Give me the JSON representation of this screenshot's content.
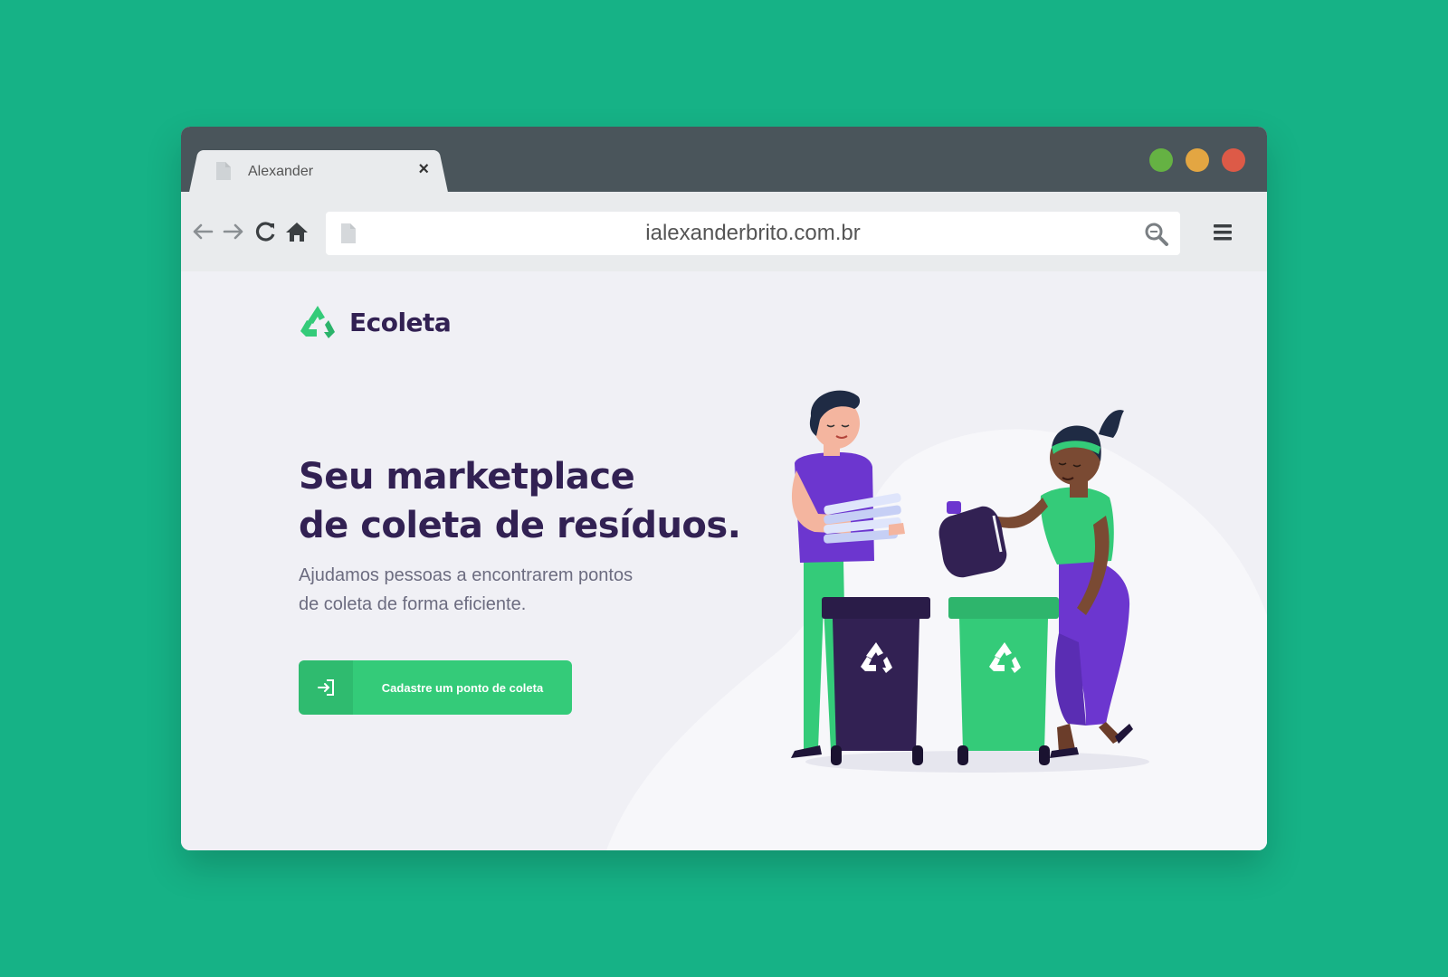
{
  "browser": {
    "tab": {
      "title": "Alexander",
      "close_symbol": "×",
      "icon": "document-icon"
    },
    "window_controls": {
      "colors": {
        "green": "#65b243",
        "yellow": "#e3a642",
        "red": "#dd5a47"
      }
    },
    "toolbar": {
      "icons": [
        "back-arrow-icon",
        "forward-arrow-icon",
        "reload-icon",
        "home-icon",
        "hamburger-menu-icon"
      ],
      "address": {
        "value": "ialexanderbrito.com.br",
        "icon": "document-icon",
        "action_icon": "search-icon"
      }
    }
  },
  "page": {
    "brand": {
      "name": "Ecoleta",
      "icon": "recycle-icon",
      "color": "#322153",
      "accent": "#34cb79"
    },
    "headline": {
      "line1": "Seu marketplace",
      "line2": "de coleta de resíduos."
    },
    "subtitle": {
      "line1": "Ajudamos pessoas a encontrarem pontos",
      "line2": "de coleta de forma eficiente."
    },
    "cta": {
      "label": "Cadastre um ponto de coleta",
      "icon": "sign-in-icon",
      "color": "#34cb79"
    },
    "illustration": {
      "subject": "people-recycling-illustration",
      "bin_icons": [
        "recycle-icon",
        "recycle-icon"
      ]
    }
  },
  "background_color": "#16b286"
}
